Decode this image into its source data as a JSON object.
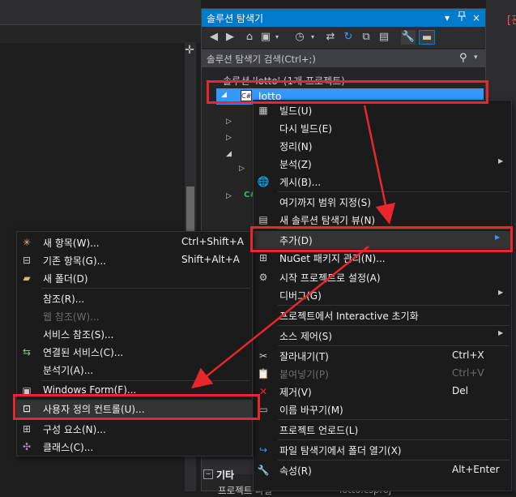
{
  "right_panel_fragment": "[관",
  "solution_explorer": {
    "title": "솔루션 탐색기",
    "title_buttons": [
      "▾",
      "⊥",
      "×"
    ],
    "search_placeholder": "솔루션 탐색기 검색(Ctrl+;)",
    "toolbar_icons": [
      "back-icon",
      "forward-icon",
      "home-icon",
      "dropdown-icon",
      "history-icon",
      "sync-icon",
      "refresh-icon",
      "collapse-all-icon",
      "show-files-icon",
      "properties-wrench-icon",
      "preview-pin-icon"
    ],
    "tree": {
      "solution_label": "솔루션 'lotto' (1개 프로젝트)",
      "project_label": "lotto",
      "project_icon_text": "C#"
    },
    "properties": {
      "category": "기타",
      "row_name": "프로젝트 파일",
      "row_value": "lotto.csproj"
    }
  },
  "context_menu": {
    "items": [
      {
        "label": "빌드(U)",
        "icon": "build-icon"
      },
      {
        "label": "다시 빌드(E)"
      },
      {
        "label": "정리(N)"
      },
      {
        "label": "분석(Z)",
        "submenu": true
      },
      {
        "label": "게시(B)...",
        "icon": "globe-icon"
      },
      {
        "label": "여기까지 범위 지정(S)"
      },
      {
        "label": "새 솔루션 탐색기 뷰(N)",
        "icon": "new-view-icon"
      },
      {
        "label": "추가(D)",
        "submenu": true,
        "highlighted": true
      },
      {
        "label": "NuGet 패키지 관리(N)...",
        "icon": "nuget-icon"
      },
      {
        "label": "시작 프로젝트로 설정(A)",
        "icon": "gear-icon"
      },
      {
        "label": "디버그(G)",
        "submenu": true
      },
      {
        "label": "프로젝트에서 Interactive 초기화"
      },
      {
        "label": "소스 제어(S)",
        "submenu": true
      },
      {
        "label": "잘라내기(T)",
        "shortcut": "Ctrl+X",
        "icon": "cut-icon"
      },
      {
        "label": "붙여넣기(P)",
        "shortcut": "Ctrl+V",
        "icon": "paste-icon",
        "disabled": true
      },
      {
        "label": "제거(V)",
        "shortcut": "Del",
        "icon": "remove-icon"
      },
      {
        "label": "이름 바꾸기(M)",
        "icon": "rename-icon"
      },
      {
        "label": "프로젝트 언로드(L)"
      },
      {
        "label": "파일 탐색기에서 폴더 열기(X)",
        "icon": "open-folder-icon"
      },
      {
        "label": "속성(R)",
        "shortcut": "Alt+Enter",
        "icon": "wrench-icon"
      }
    ]
  },
  "add_submenu": {
    "items": [
      {
        "label": "새 항목(W)...",
        "shortcut": "Ctrl+Shift+A",
        "icon": "new-item-icon"
      },
      {
        "label": "기존 항목(G)...",
        "shortcut": "Shift+Alt+A",
        "icon": "existing-item-icon"
      },
      {
        "label": "새 폴더(D)",
        "icon": "new-folder-icon"
      },
      {
        "label": "참조(R)..."
      },
      {
        "label": "웹 참조(W)...",
        "disabled": true
      },
      {
        "label": "서비스 참조(S)..."
      },
      {
        "label": "연결된 서비스(C)...",
        "icon": "connected-service-icon"
      },
      {
        "label": "분석기(A)..."
      },
      {
        "label": "Windows Form(F)...",
        "icon": "windows-form-icon"
      },
      {
        "label": "사용자 정의 컨트롤(U)...",
        "icon": "user-control-icon",
        "highlighted": true
      },
      {
        "label": "구성 요소(N)...",
        "icon": "component-icon"
      },
      {
        "label": "클래스(C)...",
        "icon": "class-icon"
      }
    ]
  },
  "colors": {
    "accent": "#007acc",
    "selection": "#3399ff",
    "annotation_red": "#e8262b"
  }
}
